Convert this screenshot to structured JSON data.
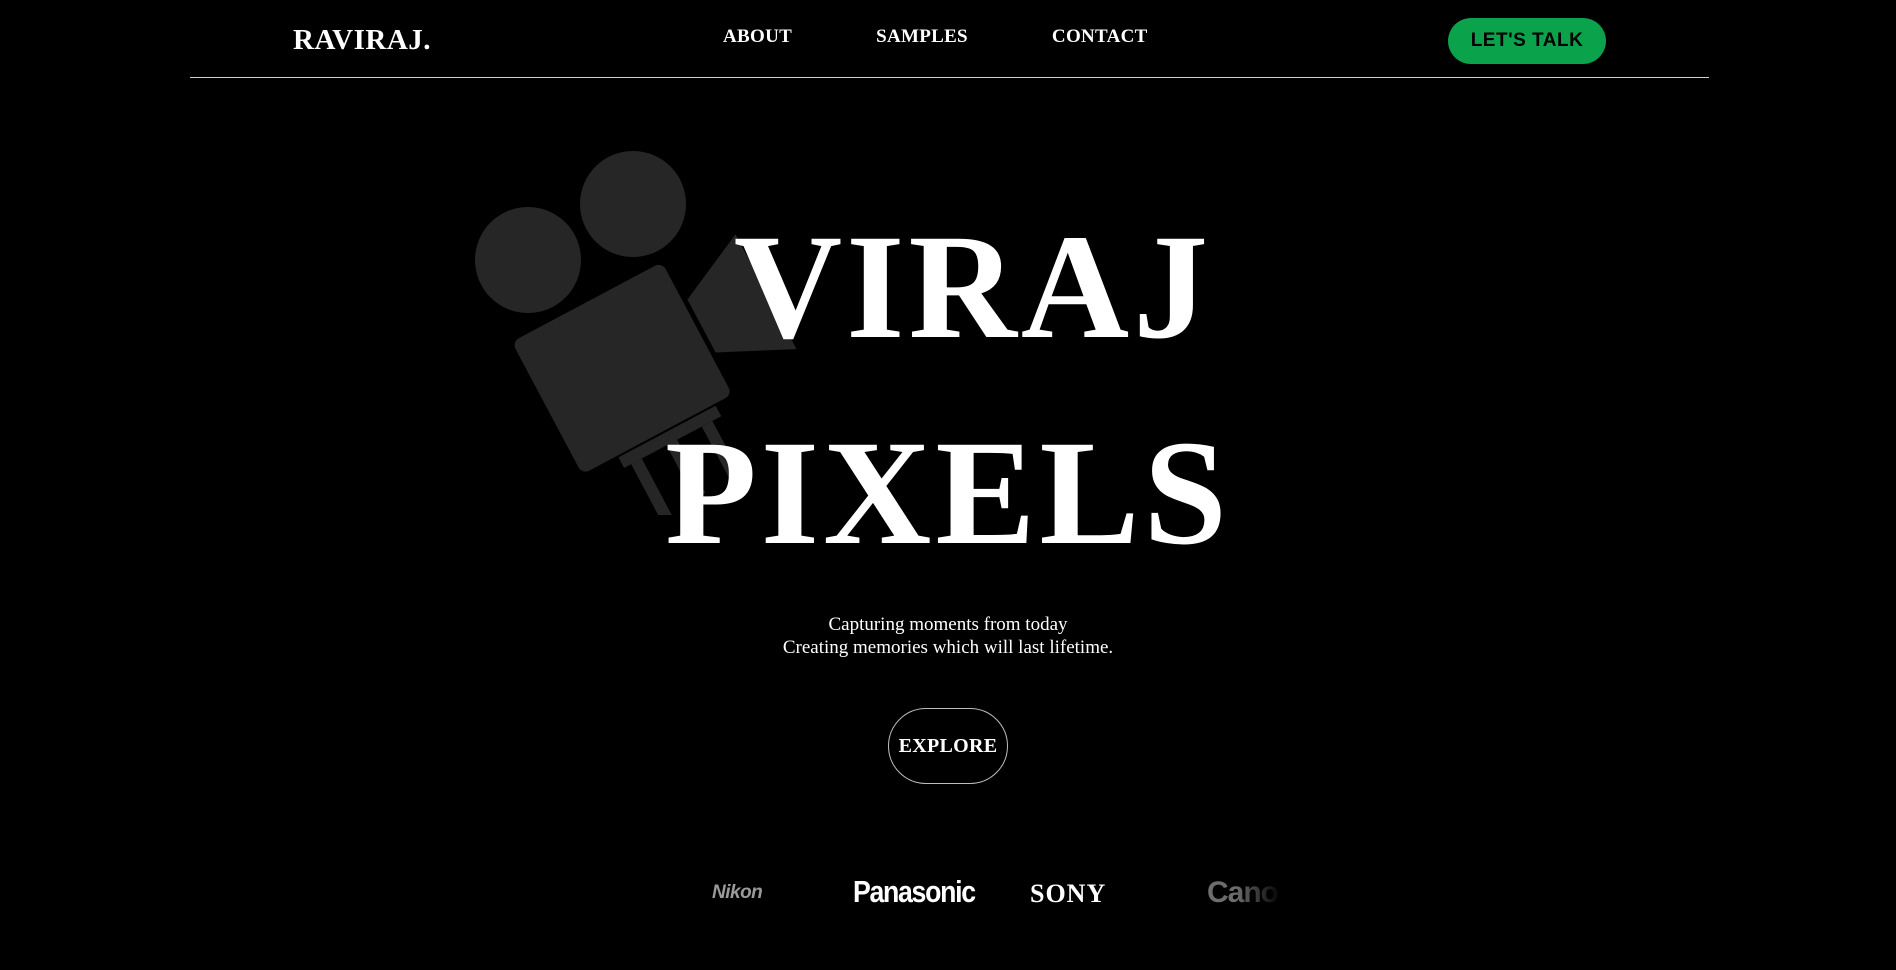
{
  "header": {
    "logo": "RAVIRAJ.",
    "nav": [
      "ABOUT",
      "SAMPLES",
      "CONTACT"
    ],
    "cta_label": "LET'S TALK"
  },
  "hero": {
    "title_line1": "VIRAJ",
    "title_line2": "PIXELS",
    "tagline_line1": "Capturing moments from today",
    "tagline_line2": "Creating memories which will last lifetime.",
    "explore_label": "EXPLORE",
    "watermark_icon": "movie-camera-icon"
  },
  "brands": [
    "Nikon",
    "Panasonic",
    "SONY",
    "Canon"
  ],
  "colors": {
    "background": "#000000",
    "accent": "#0aa24b",
    "text": "#ffffff",
    "watermark": "#262626"
  }
}
